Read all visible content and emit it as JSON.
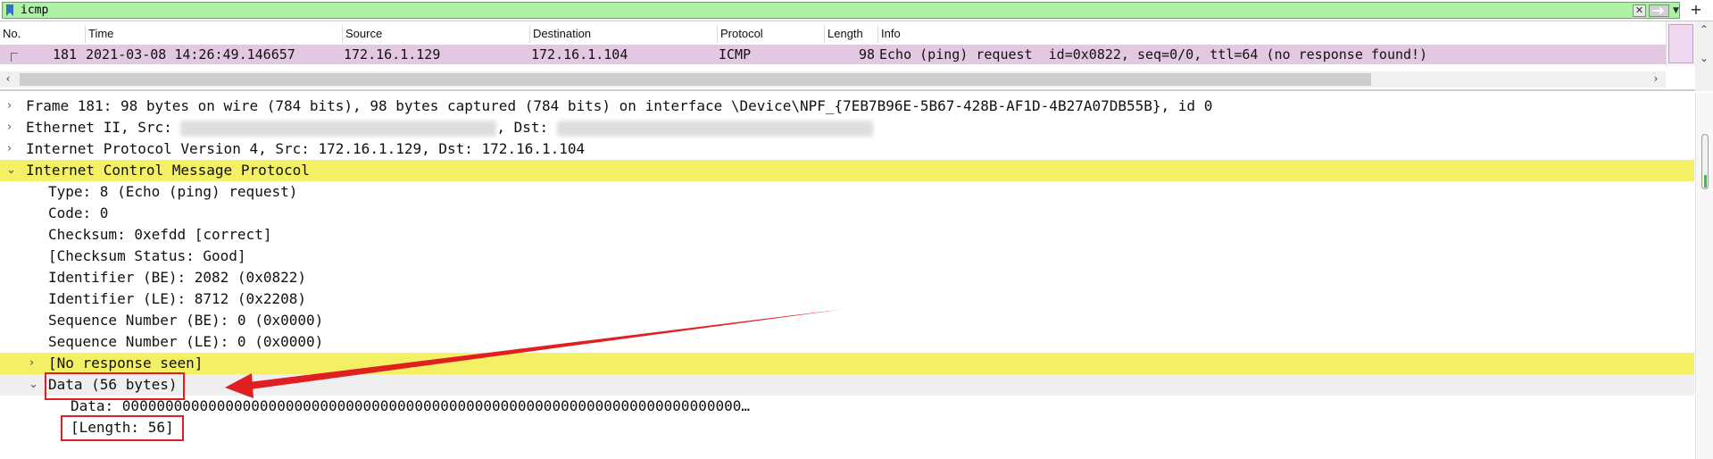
{
  "filter": {
    "value": "icmp"
  },
  "packet_list": {
    "columns": [
      "No.",
      "Time",
      "Source",
      "Destination",
      "Protocol",
      "Length",
      "Info"
    ],
    "row": {
      "no": "181",
      "time": "2021-03-08 14:26:49.146657",
      "source": "172.16.1.129",
      "destination": "172.16.1.104",
      "protocol": "ICMP",
      "length": "98",
      "info": "Echo (ping) request  id=0x0822, seq=0/0, ttl=64 (no response found!)"
    },
    "row_color": "#e3c8e1"
  },
  "details": {
    "frame": "Frame 181: 98 bytes on wire (784 bits), 98 bytes captured (784 bits) on interface \\Device\\NPF_{7EB7B96E-5B67-428B-AF1D-4B27A07DB55B}, id 0",
    "ethernet_src_label": "Ethernet II, Src: ",
    "ethernet_dst_label": ", Dst: ",
    "ipv4": "Internet Protocol Version 4, Src: 172.16.1.129, Dst: 172.16.1.104",
    "icmp": "Internet Control Message Protocol",
    "type": "Type: 8 (Echo (ping) request)",
    "code": "Code: 0",
    "checksum": "Checksum: 0xefdd [correct]",
    "checksum_status": "[Checksum Status: Good]",
    "identifier_be": "Identifier (BE): 2082 (0x0822)",
    "identifier_le": "Identifier (LE): 8712 (0x2208)",
    "seq_be": "Sequence Number (BE): 0 (0x0000)",
    "seq_le": "Sequence Number (LE): 0 (0x0000)",
    "no_response": "[No response seen]",
    "data_header": "Data (56 bytes)",
    "data_value": "Data: 000000000000000000000000000000000000000000000000000000000000000000000000…",
    "data_length": "[Length: 56]"
  },
  "colors": {
    "highlight": "#f4f066",
    "annotation": "#e02020",
    "filter_bg": "#aef2a6"
  },
  "icons": {
    "expand_collapsed": "chevron-right-icon",
    "expand_open": "chevron-down-icon"
  }
}
